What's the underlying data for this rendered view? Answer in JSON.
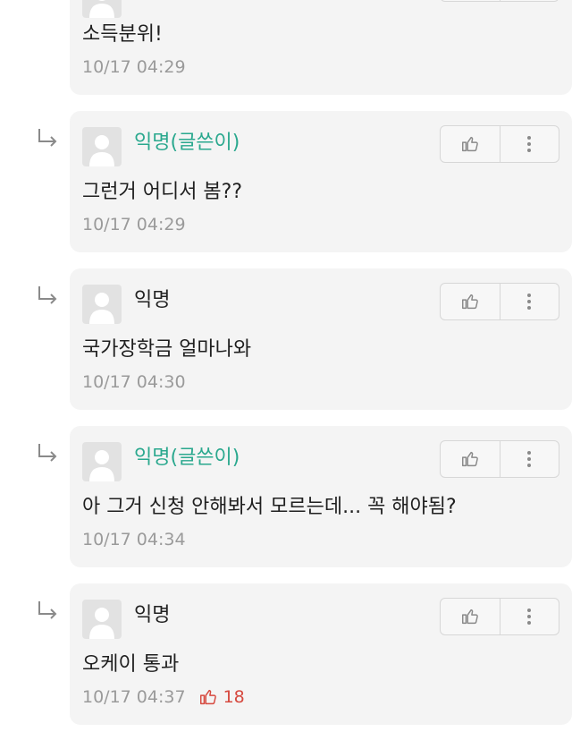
{
  "comments": [
    {
      "text": "소득분위!",
      "time": "10/17 04:29"
    },
    {
      "author": "익명(글쓴이)",
      "text": "그런거 어디서 봄??",
      "time": "10/17 04:29"
    },
    {
      "author": "익명",
      "text": "국가장학금 얼마나와",
      "time": "10/17 04:30"
    },
    {
      "author": "익명(글쓴이)",
      "text": "아 그거 신청 안해봐서 모르는데... 꼭 해야됨?",
      "time": "10/17 04:34"
    },
    {
      "author": "익명",
      "text": "오케이 통과",
      "time": "10/17 04:37",
      "likes": "18"
    }
  ],
  "icons": {
    "like": "thumbs-up-icon",
    "more": "more-vertical-icon",
    "reply": "reply-arrow-icon",
    "avatar": "default-avatar-icon"
  },
  "colors": {
    "op_name": "#2aa88e",
    "like_count": "#d6493f",
    "card_bg": "#f4f4f4"
  }
}
